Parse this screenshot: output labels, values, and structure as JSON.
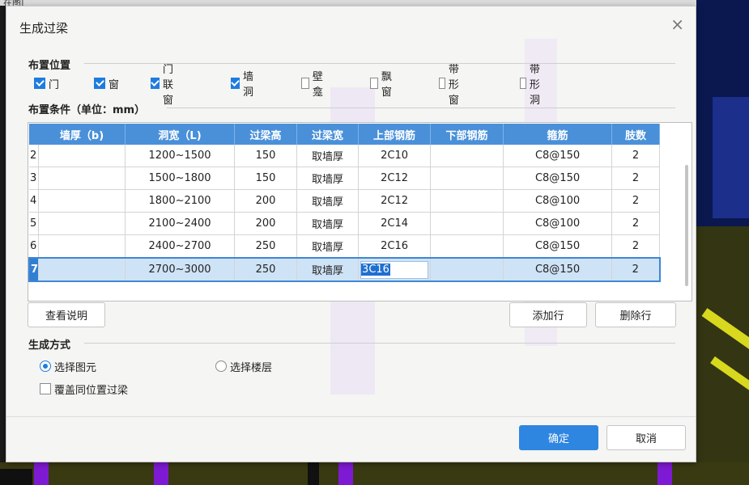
{
  "background": {
    "top_label": "在图|"
  },
  "dialog": {
    "title": "生成过梁",
    "close_label": "×",
    "placement": {
      "heading": "布置位置",
      "options": [
        {
          "label": "门",
          "checked": true
        },
        {
          "label": "窗",
          "checked": true
        },
        {
          "label": "门联窗",
          "checked": true
        },
        {
          "label": "墙洞",
          "checked": true
        },
        {
          "label": "壁龛",
          "checked": false
        },
        {
          "label": "飘窗",
          "checked": false
        },
        {
          "label": "带形窗",
          "checked": false
        },
        {
          "label": "带形洞",
          "checked": false
        }
      ]
    },
    "conditions": {
      "heading": "布置条件（单位：mm）",
      "columns": [
        "墙厚（b)",
        "洞宽（L)",
        "过梁高",
        "过梁宽",
        "上部钢筋",
        "下部钢筋",
        "箍筋",
        "肢数"
      ],
      "rows": [
        {
          "idx": "2",
          "wall": "",
          "width": "1200~1500",
          "height": "150",
          "beam_width": "取墙厚",
          "top": "2C10",
          "bottom": "",
          "stirrup": "C8@150",
          "legs": "2"
        },
        {
          "idx": "3",
          "wall": "",
          "width": "1500~1800",
          "height": "150",
          "beam_width": "取墙厚",
          "top": "2C12",
          "bottom": "",
          "stirrup": "C8@150",
          "legs": "2"
        },
        {
          "idx": "4",
          "wall": "",
          "width": "1800~2100",
          "height": "200",
          "beam_width": "取墙厚",
          "top": "2C12",
          "bottom": "",
          "stirrup": "C8@100",
          "legs": "2"
        },
        {
          "idx": "5",
          "wall": "",
          "width": "2100~2400",
          "height": "200",
          "beam_width": "取墙厚",
          "top": "2C14",
          "bottom": "",
          "stirrup": "C8@100",
          "legs": "2"
        },
        {
          "idx": "6",
          "wall": "",
          "width": "2400~2700",
          "height": "250",
          "beam_width": "取墙厚",
          "top": "2C16",
          "bottom": "",
          "stirrup": "C8@150",
          "legs": "2"
        },
        {
          "idx": "7",
          "wall": "",
          "width": "2700~3000",
          "height": "250",
          "beam_width": "取墙厚",
          "top": "3C16",
          "bottom": "",
          "stirrup": "C8@150",
          "legs": "2"
        }
      ],
      "selected_row": "7"
    },
    "buttons": {
      "help": "查看说明",
      "add_row": "添加行",
      "delete_row": "删除行",
      "ok": "确定",
      "cancel": "取消"
    },
    "generation": {
      "heading": "生成方式",
      "radio_select_element": "选择图元",
      "radio_select_floor": "选择楼层",
      "selected": "选择图元",
      "overwrite_label": "覆盖同位置过梁",
      "overwrite_checked": false
    }
  },
  "colors": {
    "accent": "#2f86e0",
    "header": "#4a90d9",
    "selection": "#cfe3f7"
  }
}
